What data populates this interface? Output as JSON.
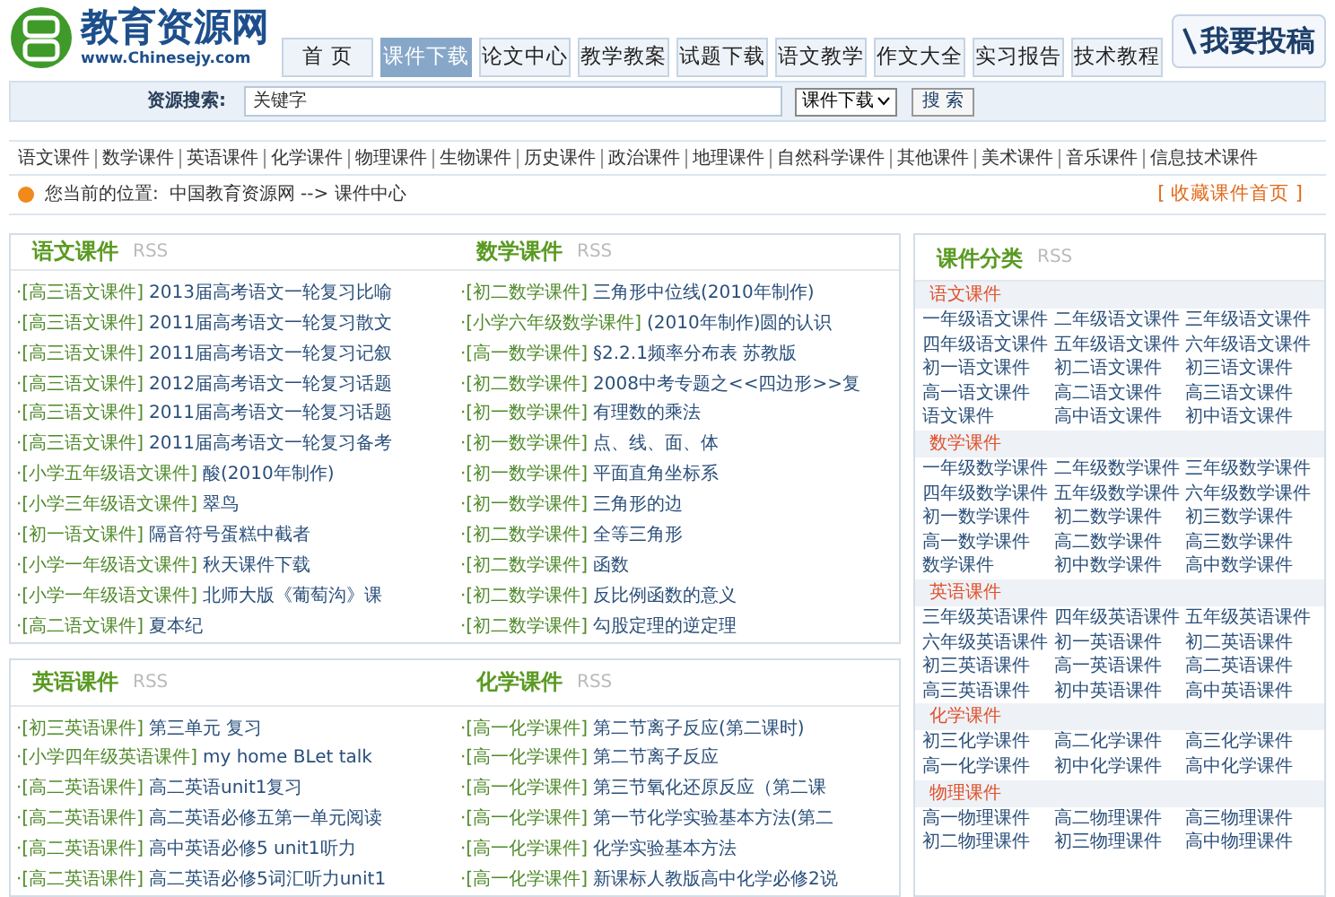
{
  "site": {
    "name": "教育资源网",
    "url": "www.Chinesejy.com"
  },
  "nav": [
    {
      "label": "首 页",
      "selected": false
    },
    {
      "label": "课件下载",
      "selected": true
    },
    {
      "label": "论文中心",
      "selected": false
    },
    {
      "label": "教学教案",
      "selected": false
    },
    {
      "label": "试题下载",
      "selected": false
    },
    {
      "label": "语文教学",
      "selected": false
    },
    {
      "label": "作文大全",
      "selected": false
    },
    {
      "label": "实习报告",
      "selected": false
    },
    {
      "label": "技术教程",
      "selected": false
    }
  ],
  "submit_button": "我要投稿",
  "search": {
    "label": "资源搜索:",
    "value": "关键字",
    "category": "课件下载",
    "button": "搜 索"
  },
  "categories": [
    "语文课件",
    "数学课件",
    "英语课件",
    "化学课件",
    "物理课件",
    "生物课件",
    "历史课件",
    "政治课件",
    "地理课件",
    "自然科学课件",
    "其他课件",
    "美术课件",
    "音乐课件",
    "信息技术课件"
  ],
  "breadcrumb": {
    "prefix": "您当前的位置:",
    "path": "中国教育资源网 --> 课件中心",
    "bookmark": "[ 收藏课件首页 ]"
  },
  "sections": [
    {
      "title": "语文课件",
      "rss": "RSS",
      "items": [
        {
          "tag": "·[高三语文课件]",
          "title": "2013届高考语文一轮复习比喻"
        },
        {
          "tag": "·[高三语文课件]",
          "title": "2011届高考语文一轮复习散文"
        },
        {
          "tag": "·[高三语文课件]",
          "title": "2011届高考语文一轮复习记叙"
        },
        {
          "tag": "·[高三语文课件]",
          "title": "2012届高考语文一轮复习话题"
        },
        {
          "tag": "·[高三语文课件]",
          "title": "2011届高考语文一轮复习话题"
        },
        {
          "tag": "·[高三语文课件]",
          "title": "2011届高考语文一轮复习备考"
        },
        {
          "tag": "·[小学五年级语文课件]",
          "title": "酸(2010年制作)"
        },
        {
          "tag": "·[小学三年级语文课件]",
          "title": "翠鸟"
        },
        {
          "tag": "·[初一语文课件]",
          "title": "隔音符号蛋糕中截者"
        },
        {
          "tag": "·[小学一年级语文课件]",
          "title": "秋天课件下载"
        },
        {
          "tag": "·[小学一年级语文课件]",
          "title": "北师大版《葡萄沟》课"
        },
        {
          "tag": "·[高二语文课件]",
          "title": "夏本纪"
        }
      ]
    },
    {
      "title": "数学课件",
      "rss": "RSS",
      "items": [
        {
          "tag": "·[初二数学课件]",
          "title": "三角形中位线(2010年制作)"
        },
        {
          "tag": "·[小学六年级数学课件]",
          "title": "(2010年制作)圆的认识"
        },
        {
          "tag": "·[高一数学课件]",
          "title": "§2.2.1频率分布表 苏教版"
        },
        {
          "tag": "·[初二数学课件]",
          "title": "2008中考专题之<<四边形>>复"
        },
        {
          "tag": "·[初一数学课件]",
          "title": "有理数的乘法"
        },
        {
          "tag": "·[初一数学课件]",
          "title": "点、线、面、体"
        },
        {
          "tag": "·[初一数学课件]",
          "title": "平面直角坐标系"
        },
        {
          "tag": "·[初一数学课件]",
          "title": "三角形的边"
        },
        {
          "tag": "·[初二数学课件]",
          "title": "全等三角形"
        },
        {
          "tag": "·[初二数学课件]",
          "title": "函数"
        },
        {
          "tag": "·[初二数学课件]",
          "title": "反比例函数的意义"
        },
        {
          "tag": "·[初二数学课件]",
          "title": "勾股定理的逆定理"
        }
      ]
    },
    {
      "title": "英语课件",
      "rss": "RSS",
      "items": [
        {
          "tag": "·[初三英语课件]",
          "title": "第三单元 复习"
        },
        {
          "tag": "·[小学四年级英语课件]",
          "title": "my home BLet talk"
        },
        {
          "tag": "·[高二英语课件]",
          "title": "高二英语unit1复习"
        },
        {
          "tag": "·[高二英语课件]",
          "title": "高二英语必修五第一单元阅读"
        },
        {
          "tag": "·[高二英语课件]",
          "title": "高中英语必修5 unit1听力"
        },
        {
          "tag": "·[高二英语课件]",
          "title": "高二英语必修5词汇听力unit1"
        }
      ]
    },
    {
      "title": "化学课件",
      "rss": "RSS",
      "items": [
        {
          "tag": "·[高一化学课件]",
          "title": "第二节离子反应(第二课时)"
        },
        {
          "tag": "·[高一化学课件]",
          "title": "第二节离子反应"
        },
        {
          "tag": "·[高一化学课件]",
          "title": "第三节氧化还原反应（第二课"
        },
        {
          "tag": "·[高一化学课件]",
          "title": "第一节化学实验基本方法(第二"
        },
        {
          "tag": "·[高一化学课件]",
          "title": "化学实验基本方法"
        },
        {
          "tag": "·[高一化学课件]",
          "title": "新课标人教版高中化学必修2说"
        }
      ]
    }
  ],
  "sidebar": {
    "title": "课件分类",
    "rss": "RSS",
    "groups": [
      {
        "title": "语文课件",
        "links": [
          "一年级语文课件",
          "二年级语文课件",
          "三年级语文课件",
          "四年级语文课件",
          "五年级语文课件",
          "六年级语文课件",
          "初一语文课件",
          "初二语文课件",
          "初三语文课件",
          "高一语文课件",
          "高二语文课件",
          "高三语文课件",
          "语文课件",
          "高中语文课件",
          "初中语文课件"
        ]
      },
      {
        "title": "数学课件",
        "links": [
          "一年级数学课件",
          "二年级数学课件",
          "三年级数学课件",
          "四年级数学课件",
          "五年级数学课件",
          "六年级数学课件",
          "初一数学课件",
          "初二数学课件",
          "初三数学课件",
          "高一数学课件",
          "高二数学课件",
          "高三数学课件",
          "数学课件",
          "初中数学课件",
          "高中数学课件"
        ]
      },
      {
        "title": "英语课件",
        "links": [
          "三年级英语课件",
          "四年级英语课件",
          "五年级英语课件",
          "六年级英语课件",
          "初一英语课件",
          "初二英语课件",
          "初三英语课件",
          "高一英语课件",
          "高二英语课件",
          "高三英语课件",
          "初中英语课件",
          "高中英语课件"
        ]
      },
      {
        "title": "化学课件",
        "links": [
          "初三化学课件",
          "高二化学课件",
          "高三化学课件",
          "高一化学课件",
          "初中化学课件",
          "高中化学课件"
        ]
      },
      {
        "title": "物理课件",
        "links": [
          "高一物理课件",
          "高二物理课件",
          "高三物理课件",
          "初二物理课件",
          "初三物理课件",
          "高中物理课件"
        ]
      }
    ]
  }
}
